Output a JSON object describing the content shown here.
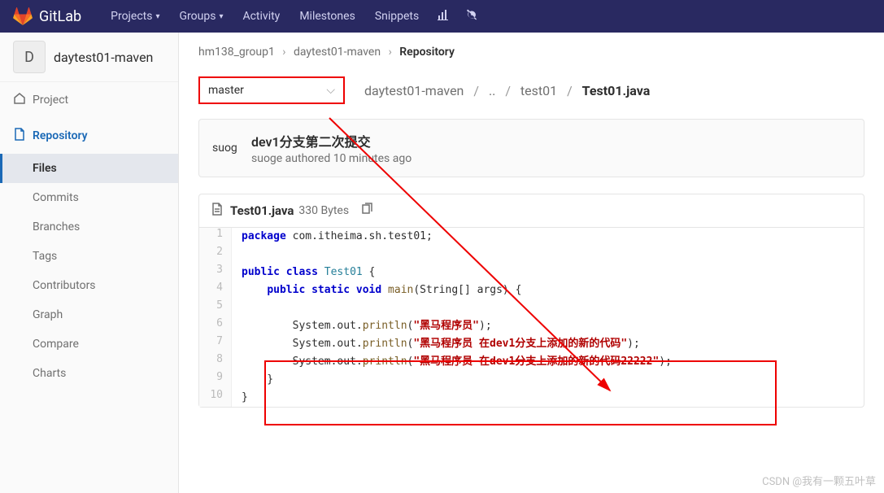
{
  "brand": "GitLab",
  "nav": {
    "projects": "Projects",
    "groups": "Groups",
    "activity": "Activity",
    "milestones": "Milestones",
    "snippets": "Snippets"
  },
  "project": {
    "initial": "D",
    "name": "daytest01-maven"
  },
  "sidebar": {
    "project": "Project",
    "repository": "Repository",
    "sub": {
      "files": "Files",
      "commits": "Commits",
      "branches": "Branches",
      "tags": "Tags",
      "contributors": "Contributors",
      "graph": "Graph",
      "compare": "Compare",
      "charts": "Charts"
    }
  },
  "breadcrumb": {
    "group": "hm138_group1",
    "project": "daytest01-maven",
    "page": "Repository"
  },
  "branch": "master",
  "path": {
    "root": "daytest01-maven",
    "dots": "..",
    "dir": "test01",
    "file": "Test01.java"
  },
  "commit": {
    "avatar": "suog",
    "title": "dev1分支第二次提交",
    "meta": "suoge authored 10 minutes ago"
  },
  "file": {
    "name": "Test01.java",
    "size": "330 Bytes"
  },
  "code": {
    "pkg_kw": "package",
    "pkg_val": " com.itheima.sh.test01;",
    "public": "public",
    "class": "class",
    "clsname": "Test01",
    "static": "static",
    "void": "void",
    "main": "main",
    "main_args": "(String[] args) {",
    "sys": "System",
    "out": ".out.",
    "println": "println",
    "s1": "\"黑马程序员\"",
    "s2": "\"黑马程序员 在dev1分支上添加的新的代码\"",
    "s3": "\"黑马程序员 在dev1分支上添加的新的代码22222\"",
    "open_brace": " {",
    "close_brace_inner": "    }",
    "close_brace_outer": "}"
  },
  "watermark": "CSDN @我有一颗五叶草"
}
